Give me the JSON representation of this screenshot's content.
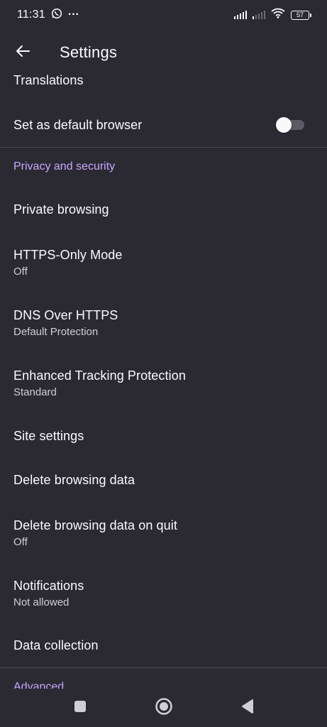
{
  "status_bar": {
    "time": "11:31",
    "overflow": "···",
    "battery": "57"
  },
  "app_bar": {
    "title": "Settings"
  },
  "settings": {
    "translations": "Translations",
    "default_browser": "Set as default browser",
    "privacy_header": "Privacy and security",
    "private_browsing": "Private browsing",
    "https_only_title": "HTTPS-Only Mode",
    "https_only_value": "Off",
    "dns_title": "DNS Over HTTPS",
    "dns_value": "Default Protection",
    "tracking_title": "Enhanced Tracking Protection",
    "tracking_value": "Standard",
    "site_settings": "Site settings",
    "delete_data": "Delete browsing data",
    "delete_on_quit_title": "Delete browsing data on quit",
    "delete_on_quit_value": "Off",
    "notifications_title": "Notifications",
    "notifications_value": "Not allowed",
    "data_collection": "Data collection",
    "advanced_header": "Advanced"
  },
  "colors": {
    "background": "#2b2a33",
    "accent": "#c9a6ff",
    "text": "#fbfbfe",
    "secondary_text": "#cfcfd8"
  },
  "icons": {
    "back": "arrow-left-icon",
    "whatsapp": "whatsapp-icon",
    "wifi": "wifi-icon",
    "nav_recents": "square-icon",
    "nav_home": "circle-icon",
    "nav_back": "triangle-back-icon"
  },
  "toggles": {
    "default_browser_on": false
  }
}
